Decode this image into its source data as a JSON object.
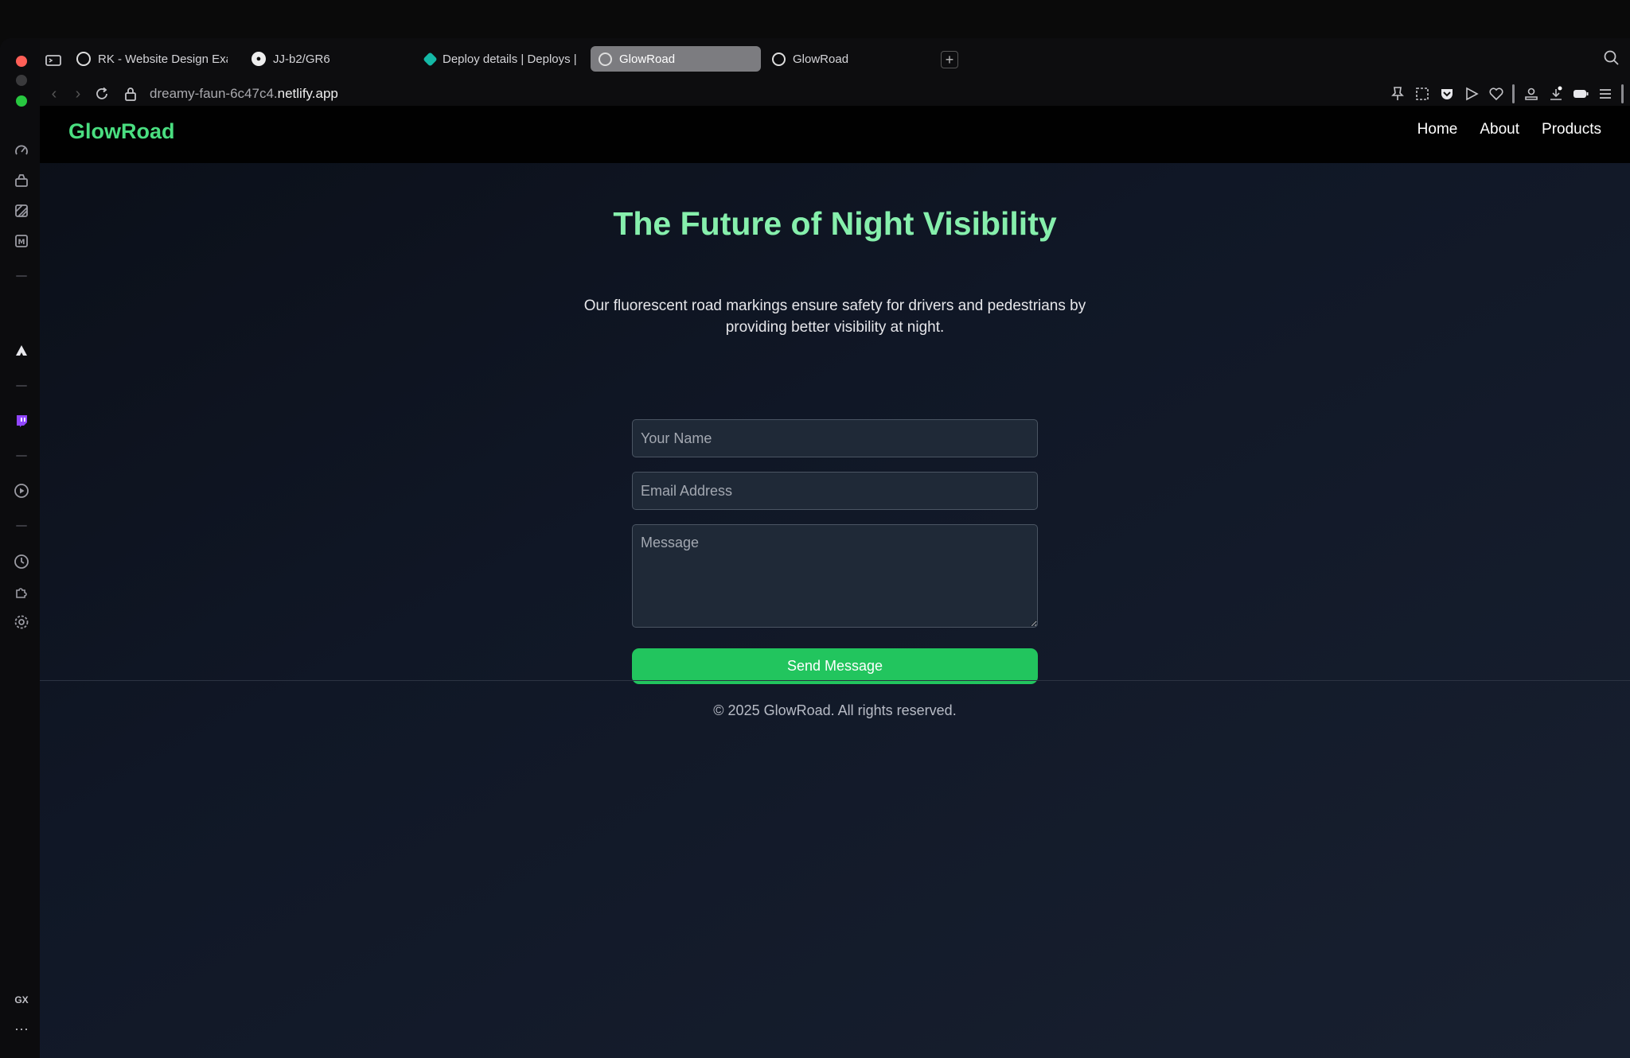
{
  "browser": {
    "tabs": [
      {
        "title": "RK - Website Design Exam",
        "icon": "target-icon"
      },
      {
        "title": "JJ-b2/GR6",
        "icon": "github-icon"
      },
      {
        "title": "Deploy details | Deploys |",
        "icon": "netlify-icon"
      },
      {
        "title": "GlowRoad",
        "icon": "globe-icon",
        "active": true
      },
      {
        "title": "GlowRoad",
        "icon": "globe-icon"
      }
    ],
    "url_path": "dreamy-faun-6c47c4.",
    "url_host": "netlify.app",
    "rail_badge": "GX",
    "more": "···"
  },
  "site": {
    "logo": "GlowRoad",
    "nav": {
      "home": "Home",
      "about": "About",
      "products": "Products"
    },
    "hero": {
      "title": "The Future of Night Visibility",
      "subtitle": "Our fluorescent road markings ensure safety for drivers and pedestrians by providing better visibility at night."
    },
    "form": {
      "name_placeholder": "Your Name",
      "email_placeholder": "Email Address",
      "message_placeholder": "Message",
      "submit_label": "Send Message"
    },
    "footer": "© 2025 GlowRoad. All rights reserved."
  },
  "colors": {
    "accent": "#22c55e",
    "logo": "#4ade80",
    "title": "#86efac"
  }
}
